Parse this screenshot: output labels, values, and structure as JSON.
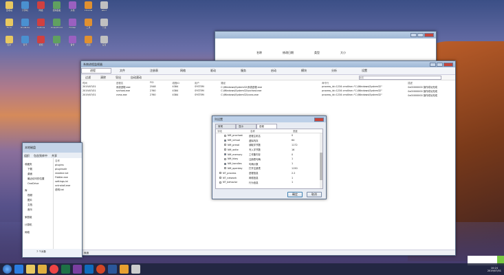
{
  "desktop": {
    "icons": [
      "回收站",
      "计算机",
      "网络",
      "控制面板",
      "文档",
      "Chrome",
      "Word",
      "Excel",
      "OneNote",
      "Outlook",
      "PowerPoint",
      "Fiddler",
      "工具",
      "下载",
      "图片",
      "音乐",
      "视频",
      "项目",
      "备份",
      "截图",
      "设置"
    ]
  },
  "back_window": {
    "title": "",
    "list": [
      "名称",
      "修改日期",
      "类型",
      "大小"
    ]
  },
  "main_window": {
    "title": "系统进程监视器",
    "tabs": [
      "进程",
      "文件",
      "注册表",
      "网络",
      "驱动",
      "服务",
      "启动",
      "模块",
      "分析",
      "设置"
    ],
    "toolbar": [
      "过滤",
      "清除",
      "导出",
      "自动滚动"
    ],
    "search_placeholder": "搜索",
    "columns": [
      "时间",
      "进程名",
      "PID",
      "线程ID",
      "用户",
      "路径",
      "命令行",
      "描述"
    ],
    "rows": [
      [
        "2019/07/01",
        "系统进程.exe",
        "2548",
        "4384",
        "SYSTEM",
        "C:\\Windows\\System32\\系统进程.exe",
        "process_id=1234 cmdline=\"C:\\Windows\\System32\"",
        "0x00000000 操作成功完成"
      ],
      [
        "2019/07/01",
        "svchost.exe",
        "2760",
        "4384",
        "SYSTEM",
        "C:\\Windows\\System32\\svchost.exe",
        "process_id=1234 cmdline=\"C:\\Windows\\System32\"",
        "0x00000000 操作成功完成"
      ],
      [
        "2019/07/01",
        "csrss.exe",
        "2760",
        "4384",
        "SYSTEM",
        "C:\\Windows\\System32\\csrss.exe",
        "process_id=1234 cmdline=\"C:\\Windows\\System32\"",
        "0x00000000 操作成功完成"
      ]
    ],
    "status": "就绪"
  },
  "dialog": {
    "title": "列设置",
    "tabs": [
      "常规",
      "显示",
      "进程"
    ],
    "columns": [
      "字段",
      "名称",
      "宽度"
    ],
    "items": [
      {
        "field": "NM_prochost",
        "name": "进程主机名",
        "value": "0",
        "checked": false
      },
      {
        "field": "NM_virtual",
        "name": "虚拟内存",
        "value": "64",
        "checked": true
      },
      {
        "field": "NM_pread",
        "name": "读取字节数",
        "value": "1172",
        "checked": false
      },
      {
        "field": "NM_write",
        "name": "写入字节数",
        "value": "16",
        "checked": false
      },
      {
        "field": "NM_memory",
        "name": "工作集内存",
        "value": "0",
        "checked": true
      },
      {
        "field": "NM_hkey",
        "name": "注册表句柄",
        "value": "1",
        "checked": false
      },
      {
        "field": "NM_handles",
        "name": "句柄计数",
        "value": "1",
        "checked": true
      },
      {
        "field": "NM_openkey",
        "name": "打开注册表",
        "value": "1150",
        "checked": false
      },
      {
        "field": "NT_process",
        "name": "进程信息",
        "value": "2.2",
        "checked": false
      },
      {
        "field": "NT_network",
        "name": "网络信息",
        "value": "1",
        "checked": false
      },
      {
        "field": "NT_behavior",
        "name": "行为信息",
        "value": "1",
        "checked": false
      }
    ],
    "ok": "确定",
    "cancel": "取消"
  },
  "explorer": {
    "path": "本地磁盘",
    "toolbar": [
      "组织",
      "包含到库中",
      "共享"
    ],
    "nav": [
      "收藏夹",
      "下载",
      "桌面",
      "最近访问的位置",
      "OneDrive",
      "库",
      "视频",
      "图片",
      "文档",
      "音乐",
      "家庭组",
      "计算机",
      "网络"
    ],
    "files_header": "名称",
    "files": [
      "plugins",
      "pluginsdir",
      "readme.txt",
      "Fiddler.exe",
      "settings.ini",
      "uninstall.exe",
      "说明.txt"
    ],
    "status": "7 个对象"
  },
  "taskbar": {
    "clock": "10:24",
    "date": "2019/07/01"
  },
  "colors": {
    "accent": "#3a6ea5",
    "notify": "#7ac943"
  }
}
